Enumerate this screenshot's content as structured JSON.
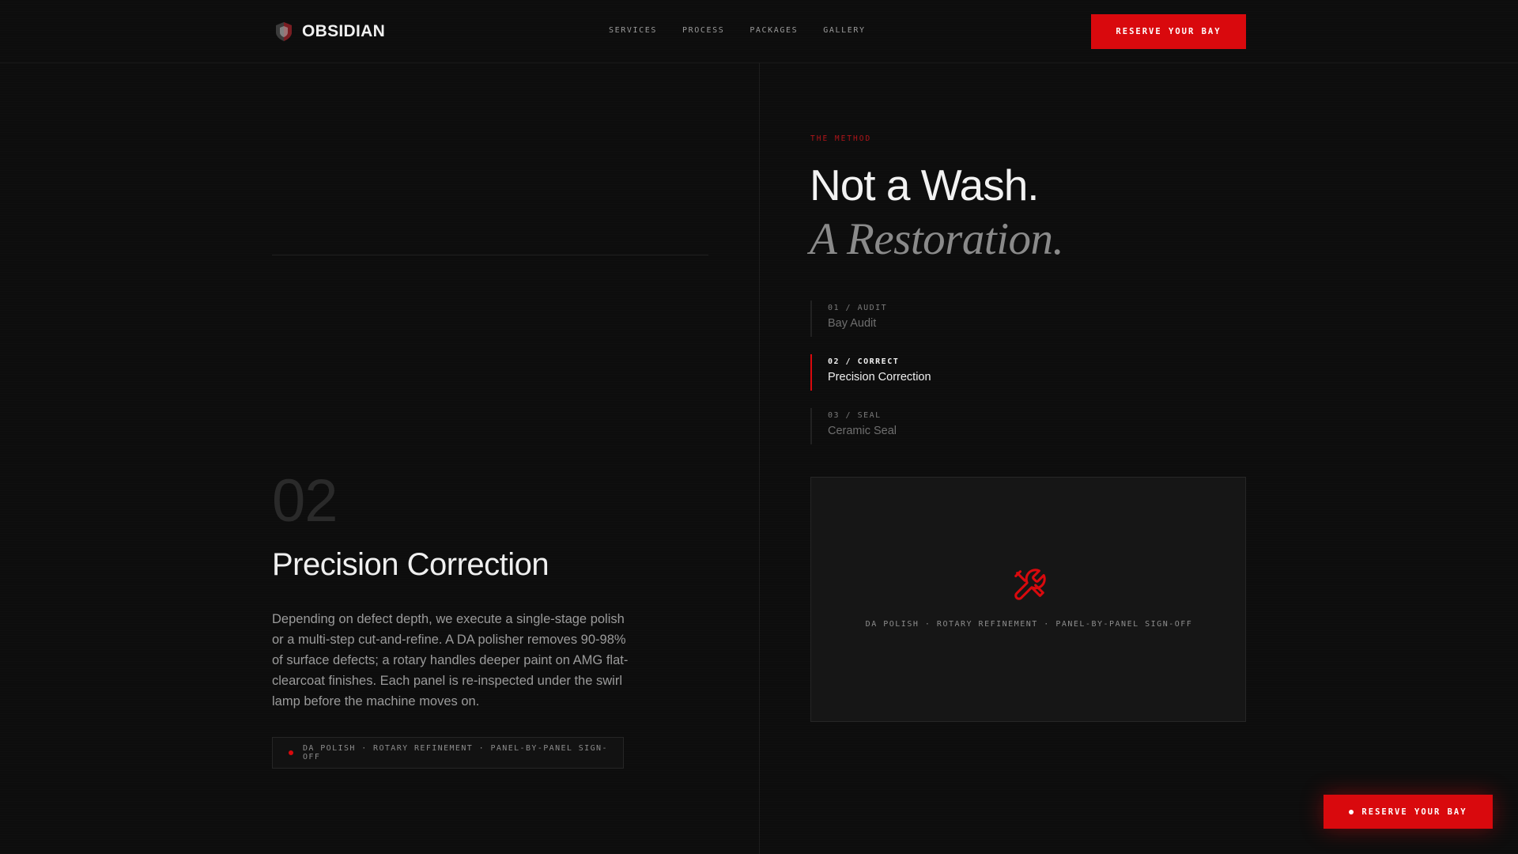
{
  "brand": {
    "name": "OBSIDIAN",
    "icon": "shield-logo-icon"
  },
  "nav": {
    "items": [
      {
        "label": "SERVICES"
      },
      {
        "label": "PROCESS"
      },
      {
        "label": "PACKAGES"
      },
      {
        "label": "GALLERY"
      }
    ]
  },
  "header": {
    "cta_label": "RESERVE YOUR BAY"
  },
  "detail": {
    "number": "02",
    "title": "Precision Correction",
    "body": "Depending on defect depth, we execute a single-stage polish or a multi-step cut-and-refine. A DA polisher removes 90-98% of surface defects; a rotary handles deeper paint on AMG flat-clearcoat finishes. Each panel is re-inspected under the swirl lamp before the machine moves on.",
    "tag": "DA POLISH · ROTARY REFINEMENT · PANEL-BY-PANEL SIGN-OFF"
  },
  "method": {
    "eyebrow": "THE METHOD",
    "headline_line1": "Not a Wash.",
    "headline_line2": "A Restoration.",
    "steps": [
      {
        "code": "01 / AUDIT",
        "label": "Bay Audit",
        "active": false
      },
      {
        "code": "02 / CORRECT",
        "label": "Precision Correction",
        "active": true
      },
      {
        "code": "03 / SEAL",
        "label": "Ceramic Seal",
        "active": false
      }
    ]
  },
  "visual": {
    "icon": "tools-icon",
    "caption": "DA POLISH · ROTARY REFINEMENT · PANEL-BY-PANEL SIGN-OFF"
  },
  "floating_cta": {
    "label": "RESERVE YOUR BAY"
  },
  "colors": {
    "accent": "#d9090d",
    "background": "#0d0d0d"
  }
}
